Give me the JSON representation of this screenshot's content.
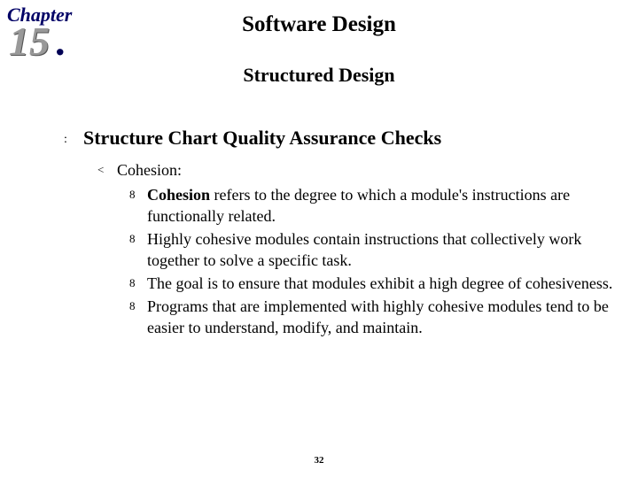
{
  "chapter": {
    "label": "Chapter",
    "number": "15",
    "dot": "."
  },
  "title": "Software Design",
  "subtitle": "Structured Design",
  "bullets": {
    "l1_glyph": ":",
    "l2_glyph": "<",
    "l3_glyph": "8"
  },
  "section": {
    "heading": "Structure Chart Quality Assurance Checks",
    "sub": {
      "label": "Cohesion:",
      "points": [
        {
          "bold": "Cohesion",
          "rest": " refers to the degree to which a module's instructions are functionally related."
        },
        {
          "bold": "",
          "rest": "Highly cohesive modules contain instructions that collectively work together to solve a specific task."
        },
        {
          "bold": "",
          "rest": "The goal is to ensure that modules exhibit a high degree of cohesiveness."
        },
        {
          "bold": "",
          "rest": "Programs that are implemented with highly cohesive modules tend to be easier to understand, modify, and maintain."
        }
      ]
    }
  },
  "page_number": "32"
}
